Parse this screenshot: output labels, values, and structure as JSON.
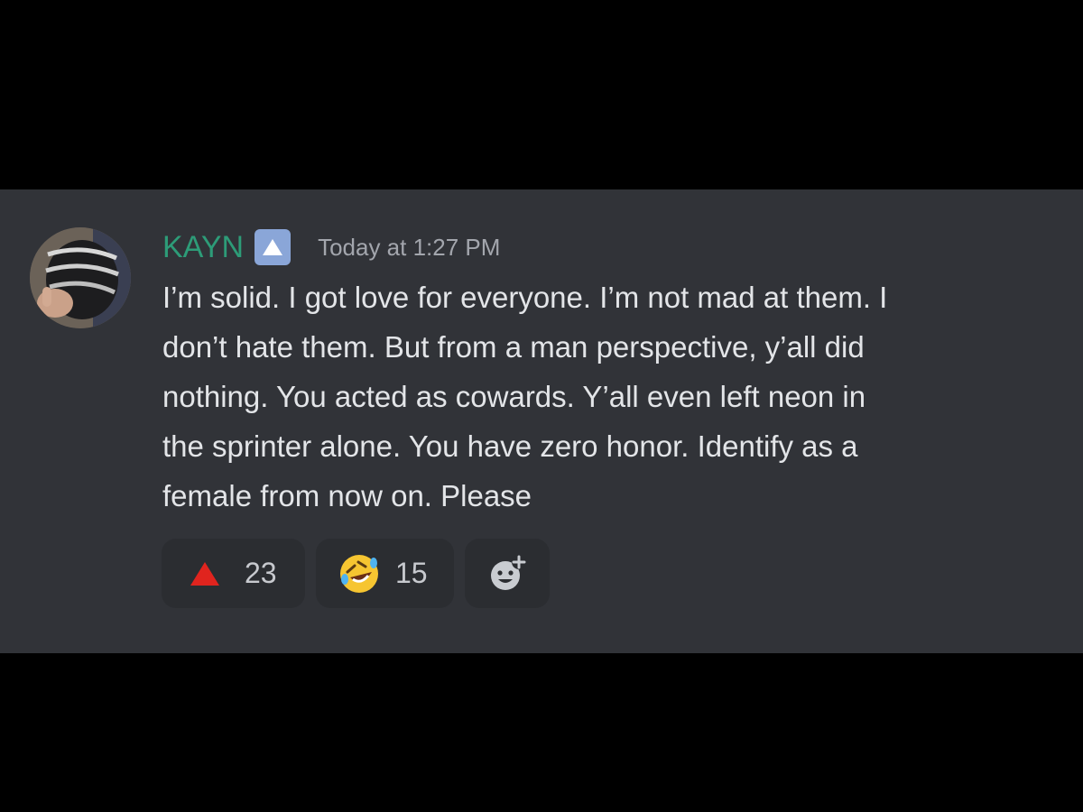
{
  "message": {
    "username": "KAYN",
    "username_color": "#2d9c78",
    "role_icon": "up-arrow-badge-icon",
    "timestamp": "Today at 1:27 PM",
    "text": "I’m solid. I got love for everyone. I’m not mad at them. I\ndon’t hate them. But from a man perspective, y’all did\nnothing. You acted as cowards. Y’all even left neon in\nthe sprinter alone. You have zero honor. Identify as a\nfemale from now on. Please"
  },
  "reactions": [
    {
      "emoji": "red-triangle-up-icon",
      "count": "23"
    },
    {
      "emoji": "rolling-on-floor-laughing-icon",
      "count": "15"
    },
    {
      "emoji": "add-reaction-icon"
    }
  ],
  "colors": {
    "background": "#000000",
    "card": "#313338",
    "reaction_bg": "#2b2d31",
    "text": "#e3e5e8",
    "muted": "#a3a6ad"
  }
}
